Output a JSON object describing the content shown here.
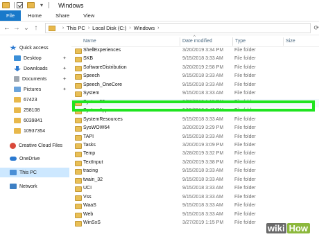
{
  "window": {
    "title": "Windows"
  },
  "ribbon": {
    "tabs": [
      "File",
      "Home",
      "Share",
      "View"
    ]
  },
  "address": {
    "crumbs": [
      "This PC",
      "Local Disk (C:)",
      "Windows"
    ]
  },
  "sidebar": {
    "items": [
      {
        "label": "Quick access",
        "icon": "star-icon",
        "color": "#2b79d0",
        "pinned": false
      },
      {
        "label": "Desktop",
        "icon": "desktop-icon",
        "color": "#3b8fd8",
        "pinned": true
      },
      {
        "label": "Downloads",
        "icon": "download-icon",
        "color": "#2b79d0",
        "pinned": true
      },
      {
        "label": "Documents",
        "icon": "documents-icon",
        "color": "#9ea7b1",
        "pinned": true
      },
      {
        "label": "Pictures",
        "icon": "pictures-icon",
        "color": "#6ba4dc",
        "pinned": true
      },
      {
        "label": "67423",
        "icon": "folder-icon",
        "color": "#e8b84b",
        "pinned": false
      },
      {
        "label": "258108",
        "icon": "folder-icon",
        "color": "#e8b84b",
        "pinned": false
      },
      {
        "label": "6039841",
        "icon": "folder-icon",
        "color": "#e8b84b",
        "pinned": false
      },
      {
        "label": "10937354",
        "icon": "folder-icon",
        "color": "#e8b84b",
        "pinned": false
      },
      {
        "label": "Creative Cloud Files",
        "icon": "creative-cloud-icon",
        "color": "#d9493b",
        "pinned": false
      },
      {
        "label": "OneDrive",
        "icon": "onedrive-icon",
        "color": "#2b79d0",
        "pinned": false
      },
      {
        "label": "This PC",
        "icon": "this-pc-icon",
        "color": "#4a8fd6",
        "pinned": false
      },
      {
        "label": "Network",
        "icon": "network-icon",
        "color": "#3d7fc4",
        "pinned": false
      }
    ]
  },
  "columns": {
    "name": "Name",
    "date": "Date modified",
    "type": "Type",
    "size": "Size"
  },
  "files": [
    {
      "name": "ShellExperiences",
      "date": "3/20/2019 3:34 PM",
      "type": "File folder"
    },
    {
      "name": "SKB",
      "date": "9/15/2018 3:33 AM",
      "type": "File folder"
    },
    {
      "name": "SoftwareDistribution",
      "date": "3/20/2019 2:58 PM",
      "type": "File folder"
    },
    {
      "name": "Speech",
      "date": "9/15/2018 3:33 AM",
      "type": "File folder"
    },
    {
      "name": "Speech_OneCore",
      "date": "9/15/2018 3:33 AM",
      "type": "File folder"
    },
    {
      "name": "System",
      "date": "9/15/2018 3:33 AM",
      "type": "File folder"
    },
    {
      "name": "System32",
      "date": "3/27/2019 1:15 PM",
      "type": "File folder"
    },
    {
      "name": "SystemApps",
      "date": "9/15/2018 8:40 PM",
      "type": "File folder"
    },
    {
      "name": "SystemResources",
      "date": "9/15/2018 3:33 AM",
      "type": "File folder"
    },
    {
      "name": "SysWOW64",
      "date": "3/20/2019 3:29 PM",
      "type": "File folder"
    },
    {
      "name": "TAPI",
      "date": "9/15/2018 3:33 AM",
      "type": "File folder"
    },
    {
      "name": "Tasks",
      "date": "3/20/2019 3:09 PM",
      "type": "File folder"
    },
    {
      "name": "Temp",
      "date": "3/28/2019 3:32 PM",
      "type": "File folder"
    },
    {
      "name": "TextInput",
      "date": "3/20/2019 3:38 PM",
      "type": "File folder"
    },
    {
      "name": "tracing",
      "date": "9/15/2018 3:33 AM",
      "type": "File folder"
    },
    {
      "name": "twain_32",
      "date": "9/15/2018 3:33 AM",
      "type": "File folder"
    },
    {
      "name": "UCI",
      "date": "9/15/2018 3:33 AM",
      "type": "File folder"
    },
    {
      "name": "Vss",
      "date": "9/15/2018 3:33 AM",
      "type": "File folder"
    },
    {
      "name": "WaaS",
      "date": "9/15/2018 3:33 AM",
      "type": "File folder"
    },
    {
      "name": "Web",
      "date": "9/15/2018 3:33 AM",
      "type": "File folder"
    },
    {
      "name": "WinSxS",
      "date": "3/27/2019 1:15 PM",
      "type": "File folder"
    }
  ],
  "selected_file": "System32",
  "highlight_color": "#1fe41f",
  "watermark": {
    "wiki": "wiki",
    "how": "How"
  }
}
